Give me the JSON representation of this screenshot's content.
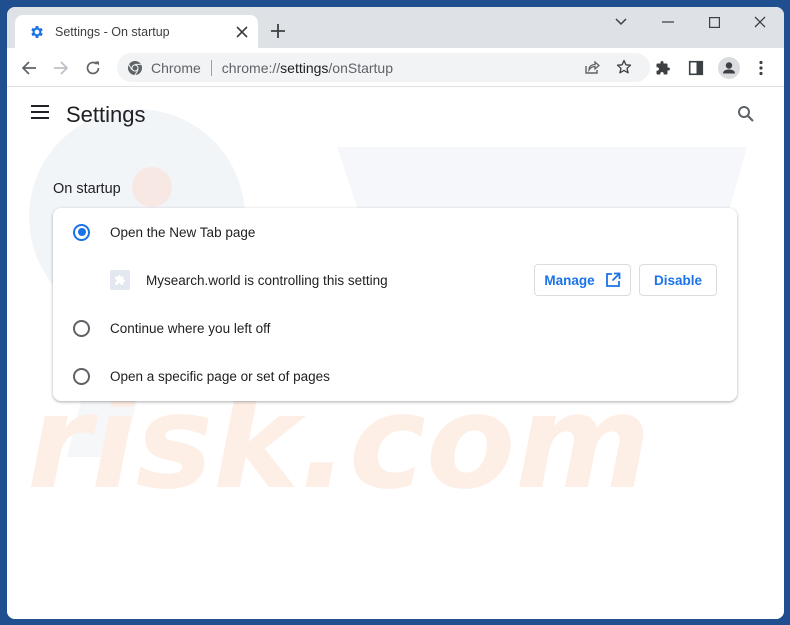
{
  "browser": {
    "tab_title": "Settings - On startup",
    "new_tab_label": "+",
    "omnibox": {
      "chip_label": "Chrome",
      "url_prefix": "chrome://",
      "url_host": "settings",
      "url_path": "/onStartup"
    }
  },
  "settings": {
    "page_title": "Settings",
    "section_title": "On startup",
    "options": [
      {
        "label": "Open the New Tab page",
        "selected": true
      },
      {
        "label": "Continue where you left off",
        "selected": false
      },
      {
        "label": "Open a specific page or set of pages",
        "selected": false
      }
    ],
    "extension_notice": {
      "text": "Mysearch.world is controlling this setting",
      "manage_label": "Manage",
      "disable_label": "Disable"
    }
  },
  "watermark": {
    "text": "risk.com"
  },
  "colors": {
    "accent": "#1a73e8",
    "desktop": "#1f4f8f",
    "titlebar": "#dee1e6"
  }
}
